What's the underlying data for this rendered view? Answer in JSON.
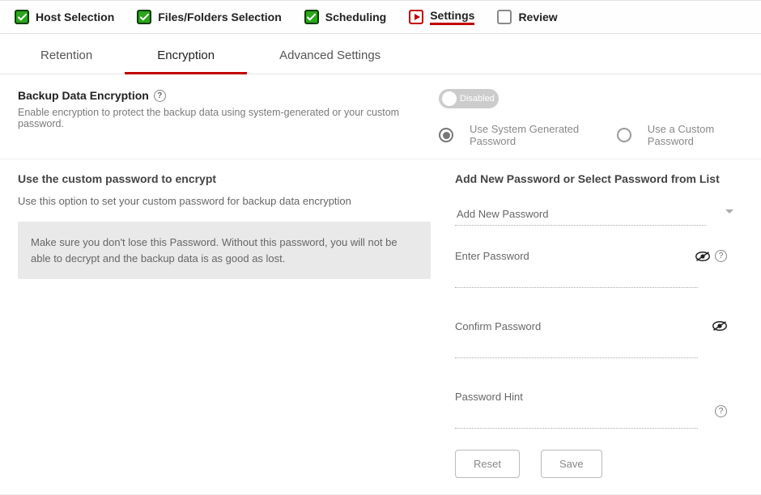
{
  "wizard": {
    "steps": [
      {
        "label": "Host Selection",
        "state": "done"
      },
      {
        "label": "Files/Folders Selection",
        "state": "done"
      },
      {
        "label": "Scheduling",
        "state": "done"
      },
      {
        "label": "Settings",
        "state": "current"
      },
      {
        "label": "Review",
        "state": "pending"
      }
    ]
  },
  "tabs": {
    "items": [
      "Retention",
      "Encryption",
      "Advanced Settings"
    ],
    "active_index": 1
  },
  "encryption_section": {
    "title": "Backup Data Encryption",
    "description": "Enable encryption to protect the backup data using system-generated or your custom password.",
    "toggle": {
      "state": "Disabled"
    },
    "radio_options": [
      {
        "label": "Use System Generated Password",
        "selected": true
      },
      {
        "label": "Use a Custom Password",
        "selected": false
      }
    ]
  },
  "custom_pw_section": {
    "title": "Use the custom password to encrypt",
    "description": "Use this option to set your custom password for backup data encryption",
    "warning": "Make sure you don't lose this Password. Without this password, you will not be able to decrypt and the backup data is as good as lost."
  },
  "add_pw_section": {
    "title": "Add New Password or Select Password from List",
    "dropdown_value": "Add New Password",
    "enter_label": "Enter Password",
    "confirm_label": "Confirm Password",
    "hint_label": "Password Hint",
    "reset_btn": "Reset",
    "save_btn": "Save"
  },
  "icons": {
    "help": "?",
    "eye_off": "eye-off-icon",
    "chevron_down": "chevron-down-icon"
  }
}
